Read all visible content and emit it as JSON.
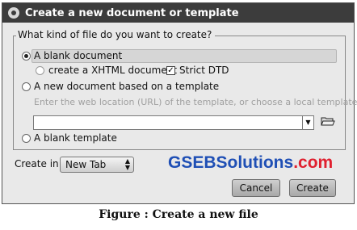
{
  "dialog": {
    "title": "Create a new document or template",
    "group_legend": "What kind of file do you want to create?",
    "options": {
      "blank_document": "A blank document",
      "xhtml_label": "create a XHTML document",
      "strict_dtd_label": "Strict DTD",
      "from_template": "A new document based on a template",
      "template_hint": "Enter the web location (URL) of the template, or choose a local template:",
      "blank_template": "A blank template"
    },
    "url_input": {
      "value": "",
      "placeholder": ""
    },
    "create_in_label": "Create in:",
    "create_in_value": "New Tab",
    "cancel_label": "Cancel",
    "create_label": "Create"
  },
  "watermark": {
    "part1": "GSEB",
    "part2": "Solutions",
    "part3": ".com"
  },
  "caption": "Figure : Create a new file",
  "icons": {
    "title": "circle-icon",
    "folder": "folder-open-icon",
    "dropdown": "chevron-down-icon",
    "combo": "up-down-arrows-icon"
  }
}
